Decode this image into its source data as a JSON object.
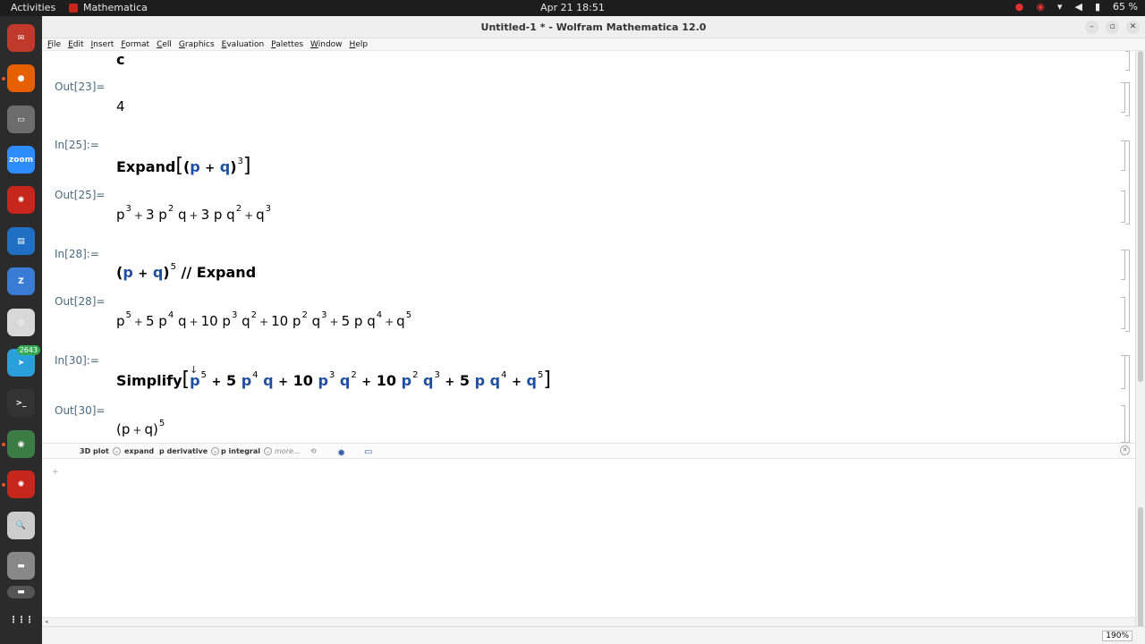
{
  "topbar": {
    "activities": "Activities",
    "app_name": "Mathematica",
    "clock": "Apr 21  18:51",
    "battery": "65 %"
  },
  "dock": {
    "items": [
      {
        "name": "mail",
        "color": "#c0392b",
        "glyph": "✉"
      },
      {
        "name": "firefox",
        "color": "#e66000",
        "glyph": "●"
      },
      {
        "name": "files",
        "color": "#6d6d6d",
        "glyph": "▭"
      },
      {
        "name": "zoom",
        "color": "#2d8cff",
        "glyph": "zoom"
      },
      {
        "name": "mathematica-1",
        "color": "#c7261c",
        "glyph": "✺"
      },
      {
        "name": "writer",
        "color": "#1f6fc5",
        "glyph": "▤"
      },
      {
        "name": "zotero",
        "color": "#3a7bd5",
        "glyph": "Z"
      },
      {
        "name": "document-viewer",
        "color": "#d8d8d8",
        "glyph": "◎"
      },
      {
        "name": "telegram",
        "color": "#2aa0da",
        "glyph": "➤",
        "badge": "2643"
      },
      {
        "name": "terminal",
        "color": "#333333",
        "glyph": ">_"
      },
      {
        "name": "camera",
        "color": "#3d7b44",
        "glyph": "◉"
      },
      {
        "name": "mathematica-2",
        "color": "#c7261c",
        "glyph": "✺"
      },
      {
        "name": "search",
        "color": "#cccccc",
        "glyph": "🔍"
      },
      {
        "name": "drive",
        "color": "#888888",
        "glyph": "▬"
      },
      {
        "name": "drive-2",
        "color": "#555555",
        "glyph": "▬"
      },
      {
        "name": "apps-grid",
        "color": "#2b2b2b",
        "glyph": "⋮⋮⋮"
      }
    ]
  },
  "window": {
    "title": "Untitled-1 * - Wolfram Mathematica 12.0",
    "menu": [
      "File",
      "Edit",
      "Insert",
      "Format",
      "Cell",
      "Graphics",
      "Evaluation",
      "Palettes",
      "Window",
      "Help"
    ]
  },
  "notebook": {
    "top_partial_output": "c",
    "out23_label": "Out[23]=",
    "out23_value": "4",
    "in25_label": "In[25]:=",
    "in25": {
      "fn": "Expand",
      "p": "p",
      "plus": "+",
      "q": "q",
      "exp": "3"
    },
    "out25_label": "Out[25]=",
    "out25": {
      "t1": "p",
      "e1": "3",
      "t2": "3 p",
      "e2": "2",
      "t2b": "q",
      "t3": "3 p q",
      "e3": "2",
      "t4": "q",
      "e4": "3",
      "plus": "+"
    },
    "in28_label": "In[28]:=",
    "in28": {
      "p": "p",
      "plus": "+",
      "q": "q",
      "exp": "5",
      "postfix": "// Expand"
    },
    "out28_label": "Out[28]=",
    "out28": {
      "a": "p",
      "ae": "5",
      "b": "5 p",
      "be": "4",
      "bq": "q",
      "c": "10 p",
      "ce": "3",
      "cq": "q",
      "cqe": "2",
      "d": "10 p",
      "de": "2",
      "dq": "q",
      "dqe": "3",
      "e": "5 p q",
      "ee": "4",
      "f": "q",
      "fe": "5",
      "plus": "+"
    },
    "in30_label": "In[30]:=",
    "in30": {
      "fn": "Simplify",
      "a": "p",
      "ae": "5",
      "b": "5",
      "bp": "p",
      "be": "4",
      "bq": "q",
      "c": "10",
      "cp": "p",
      "ce": "3",
      "cq": "q",
      "cqe": "2",
      "d": "10",
      "dp": "p",
      "de": "2",
      "dq": "q",
      "dqe": "3",
      "e": "5",
      "ep": "p",
      "eq": "q",
      "ee": "4",
      "f": "q",
      "fe": "5",
      "plus": "+"
    },
    "out30_label": "Out[30]=",
    "out30": {
      "p": "p",
      "plus": "+",
      "q": "q",
      "exp": "5"
    }
  },
  "suggestions": {
    "items": [
      "3D plot",
      "expand",
      "p derivative",
      "p integral"
    ],
    "more": "more..."
  },
  "status": {
    "zoom": "190%"
  }
}
